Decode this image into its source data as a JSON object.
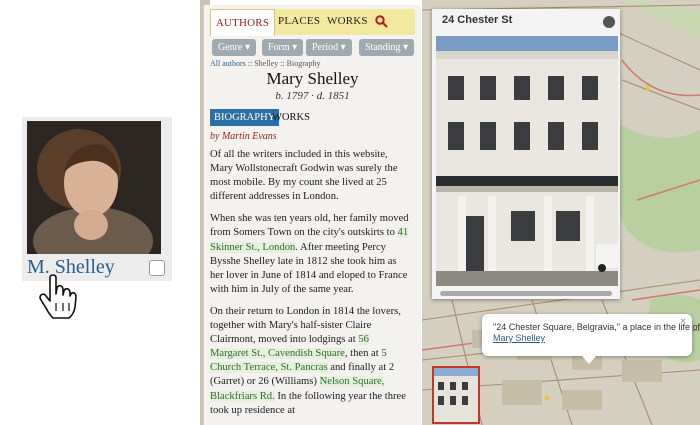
{
  "card": {
    "name": "M. Shelley"
  },
  "nav": {
    "authors": "AUTHORS",
    "places": "PLACES",
    "works": "WORKS",
    "search_icon": "search-icon"
  },
  "filters": [
    "Genre",
    "Form",
    "Period",
    "Standing"
  ],
  "breadcrumb": {
    "root": "All authors",
    "rest": " :: Shelley :: Biography"
  },
  "author": {
    "name": "Mary Shelley",
    "dates": "b. 1797 · d. 1851"
  },
  "tabs": {
    "biography": "BIOGRAPHY",
    "works": "WORKS"
  },
  "byline": "by Martin Evans",
  "bio": {
    "p1": "Of all the writers included in this website, Mary Wollstonecraft Godwin was surely the most mobile. By my count she lived at 25 different addresses in London.",
    "p2a": "When she was ten years old, her family moved from Somers Town on the city's outskirts to ",
    "p2link": "41 Skinner St., London",
    "p2b": ". After meeting Percy Bysshe Shelley late in 1812 she took him as her lover in June of 1814 and eloped to France with him in July of the same year.",
    "p3a": "On their return to London in 1814 the lovers, together with Mary's half-sister Claire Clairmont, moved into lodgings at ",
    "p3link1": "56 Margaret St., Cavendish Square",
    "p3b": ", then at ",
    "p3link2": "5 Church Terrace, St. Pancras",
    "p3c": " and finally at 2 (Garret) or 26 (Williams) ",
    "p3link3": "Nelson Square, Blackfriars Rd.",
    "p3d": " In the following year the three took up residence at"
  },
  "photo": {
    "title": "24 Chester St"
  },
  "popup": {
    "text": "\"24 Chester Square, Belgravia,\" a place in the life of",
    "link": "Mary Shelley",
    "close": "×"
  }
}
